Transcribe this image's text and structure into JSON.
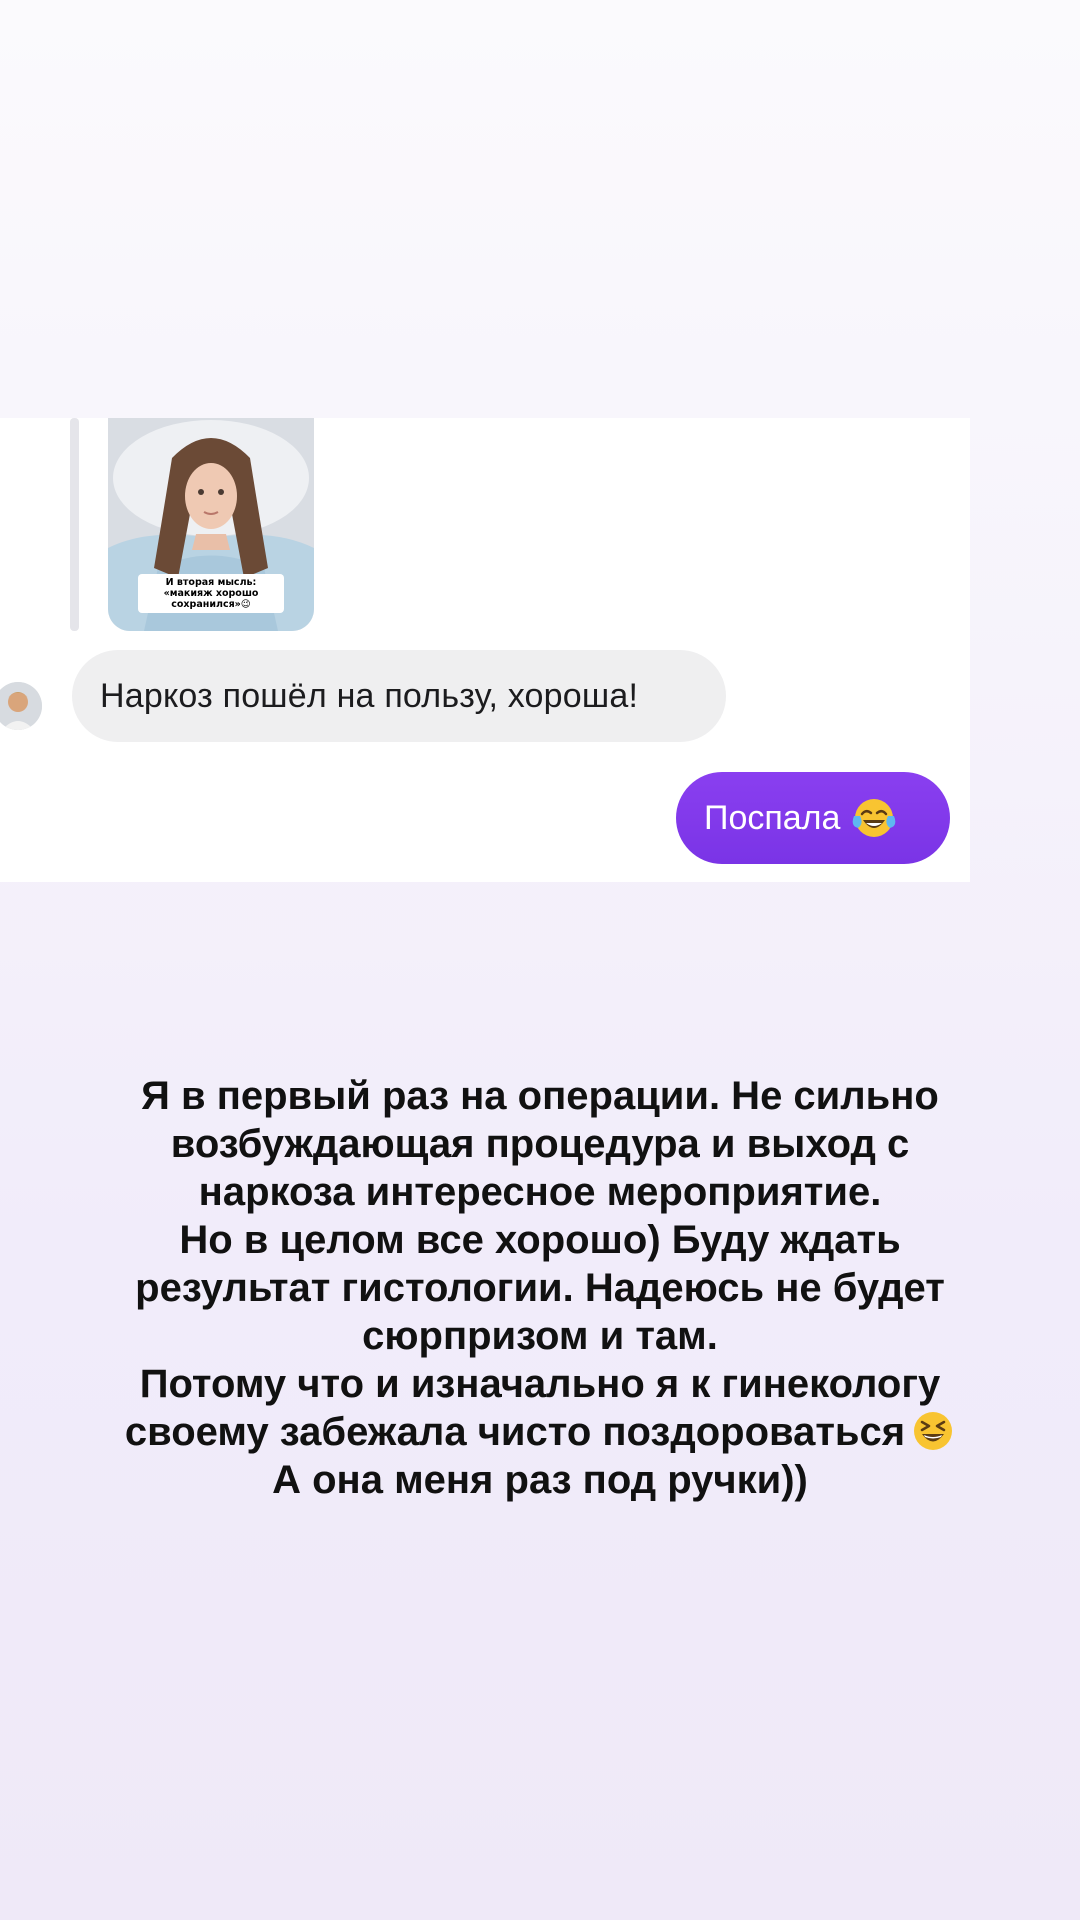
{
  "chat": {
    "photo_caption": "И вторая мысль: «макияж хорошо сохранился»😉",
    "incoming_message": "Наркоз пошёл на пользу, хороша!",
    "outgoing_message": "Поспала",
    "outgoing_emoji": "face-with-tears-of-joy-icon"
  },
  "story": {
    "lines": [
      "Я в первый раз на операции. Не сильно",
      "возбуждающая процедура и выход с",
      "наркоза интересное мероприятие.",
      "Но в целом все хорошо) Буду ждать",
      "результат гистологии. Надеюсь не будет",
      "сюрпризом и там.",
      "Потому что и изначально я к гинекологу",
      "своему забежала чисто поздороваться",
      "А она меня раз под ручки))"
    ],
    "line8_emoji": "grinning-squinting-face-icon"
  },
  "colors": {
    "outgoing_bubble": "#7c3aed",
    "incoming_bubble": "#efeff0",
    "text": "#111111"
  }
}
